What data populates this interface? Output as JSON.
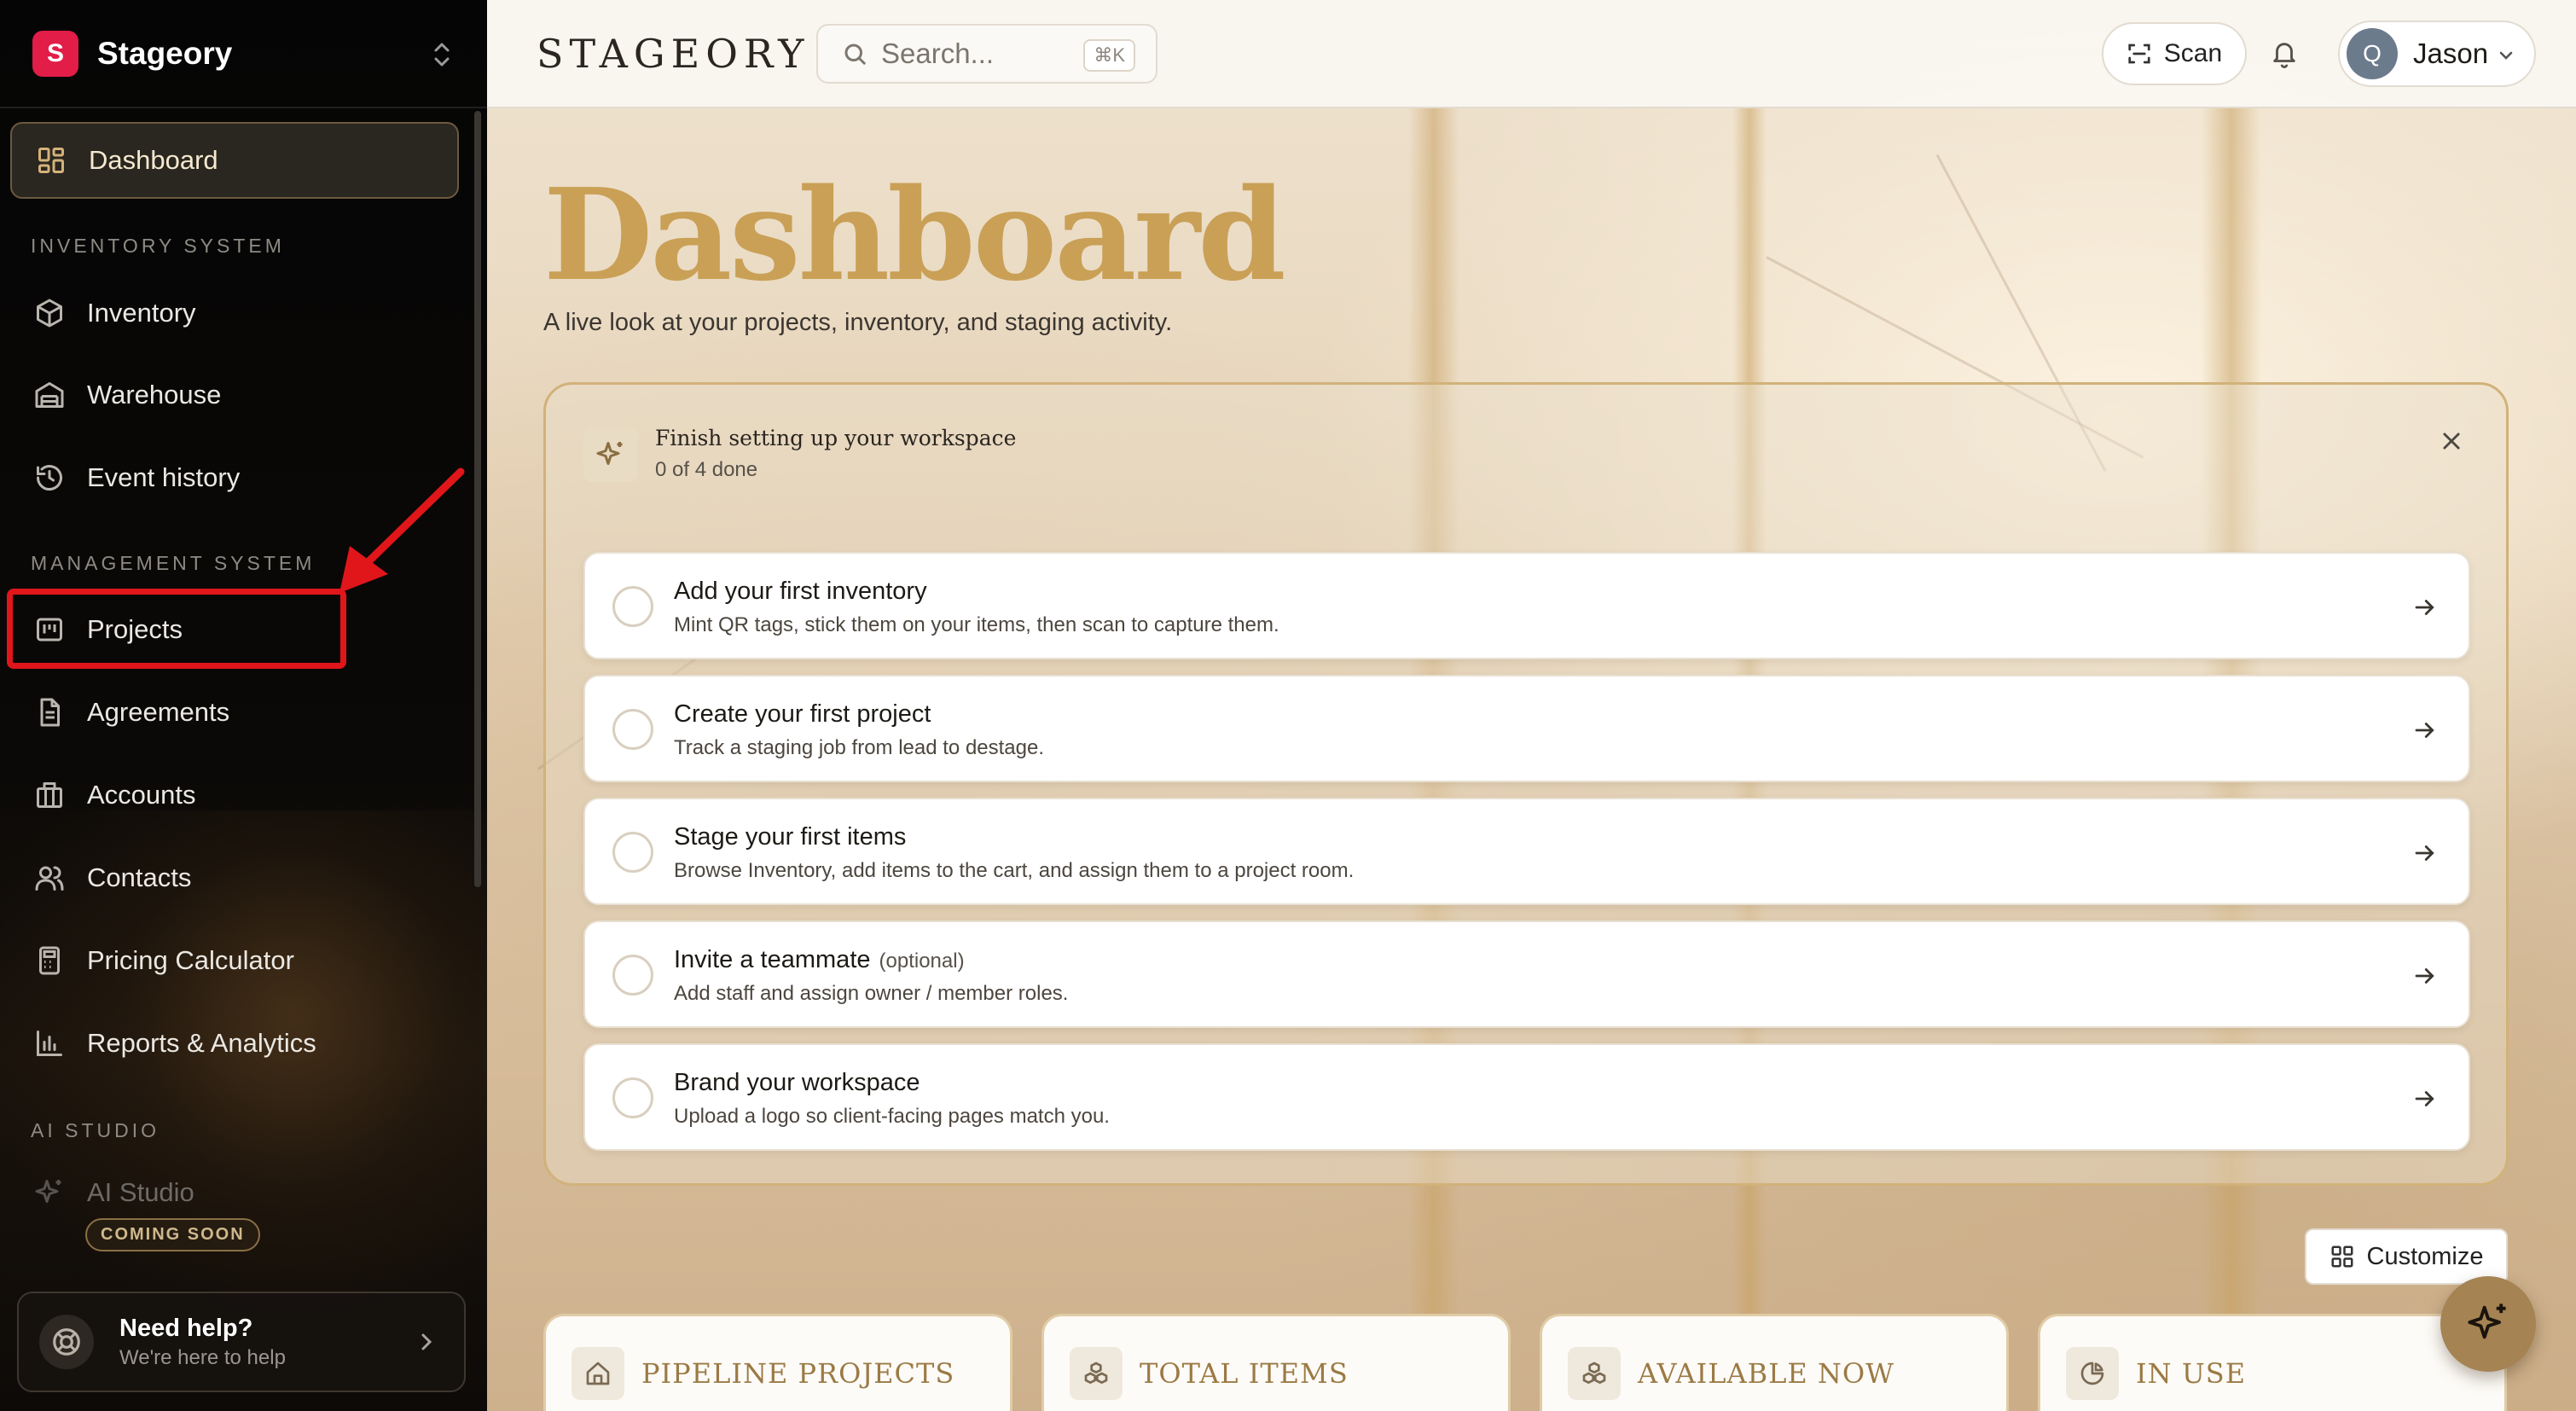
{
  "workspace": {
    "name": "Stageory",
    "logo_letter": "S",
    "logo_color": "#e11d48"
  },
  "sidebar": {
    "dashboard_label": "Dashboard",
    "sections": {
      "inventory": "INVENTORY SYSTEM",
      "management": "MANAGEMENT SYSTEM",
      "ai": "AI STUDIO"
    },
    "items": {
      "inventory": "Inventory",
      "warehouse": "Warehouse",
      "event_history": "Event history",
      "projects": "Projects",
      "agreements": "Agreements",
      "accounts": "Accounts",
      "contacts": "Contacts",
      "pricing_calculator": "Pricing Calculator",
      "reports": "Reports & Analytics",
      "ai_studio": "AI Studio"
    },
    "ai_badge": "COMING SOON",
    "help": {
      "title": "Need help?",
      "subtitle": "We're here to help"
    }
  },
  "topbar": {
    "brand": "STAGEORY",
    "search_placeholder": "Search...",
    "search_shortcut": "⌘K",
    "scan_label": "Scan",
    "user_initial": "Q",
    "user_name": "Jason"
  },
  "page": {
    "title": "Dashboard",
    "subtitle": "A live look at your projects, inventory, and staging activity."
  },
  "setup": {
    "title": "Finish setting up your workspace",
    "progress": "0 of 4 done",
    "tasks": [
      {
        "title": "Add your first inventory",
        "optional": "",
        "desc": "Mint QR tags, stick them on your items, then scan to capture them."
      },
      {
        "title": "Create your first project",
        "optional": "",
        "desc": "Track a staging job from lead to destage."
      },
      {
        "title": "Stage your first items",
        "optional": "",
        "desc": "Browse Inventory, add items to the cart, and assign them to a project room."
      },
      {
        "title": "Invite a teammate",
        "optional": "(optional)",
        "desc": "Add staff and assign owner / member roles."
      },
      {
        "title": "Brand your workspace",
        "optional": "",
        "desc": "Upload a logo so client-facing pages match you."
      }
    ]
  },
  "customize_label": "Customize",
  "stats": {
    "pipeline": "PIPELINE PROJECTS",
    "total": "TOTAL ITEMS",
    "available": "AVAILABLE NOW",
    "in_use": "IN USE"
  },
  "colors": {
    "accent_gold": "#c9a056",
    "highlight_red": "#e0161b",
    "sidebar_bg": "#050505"
  },
  "icons": {
    "dashboard": "grid-icon",
    "inventory": "cube-icon",
    "warehouse": "warehouse-icon",
    "event_history": "history-icon",
    "projects": "kanban-icon",
    "agreements": "document-icon",
    "accounts": "building-icon",
    "contacts": "users-icon",
    "pricing": "calculator-icon",
    "reports": "bar-chart-icon",
    "ai": "sparkles-icon",
    "help": "lifebuoy-icon"
  }
}
